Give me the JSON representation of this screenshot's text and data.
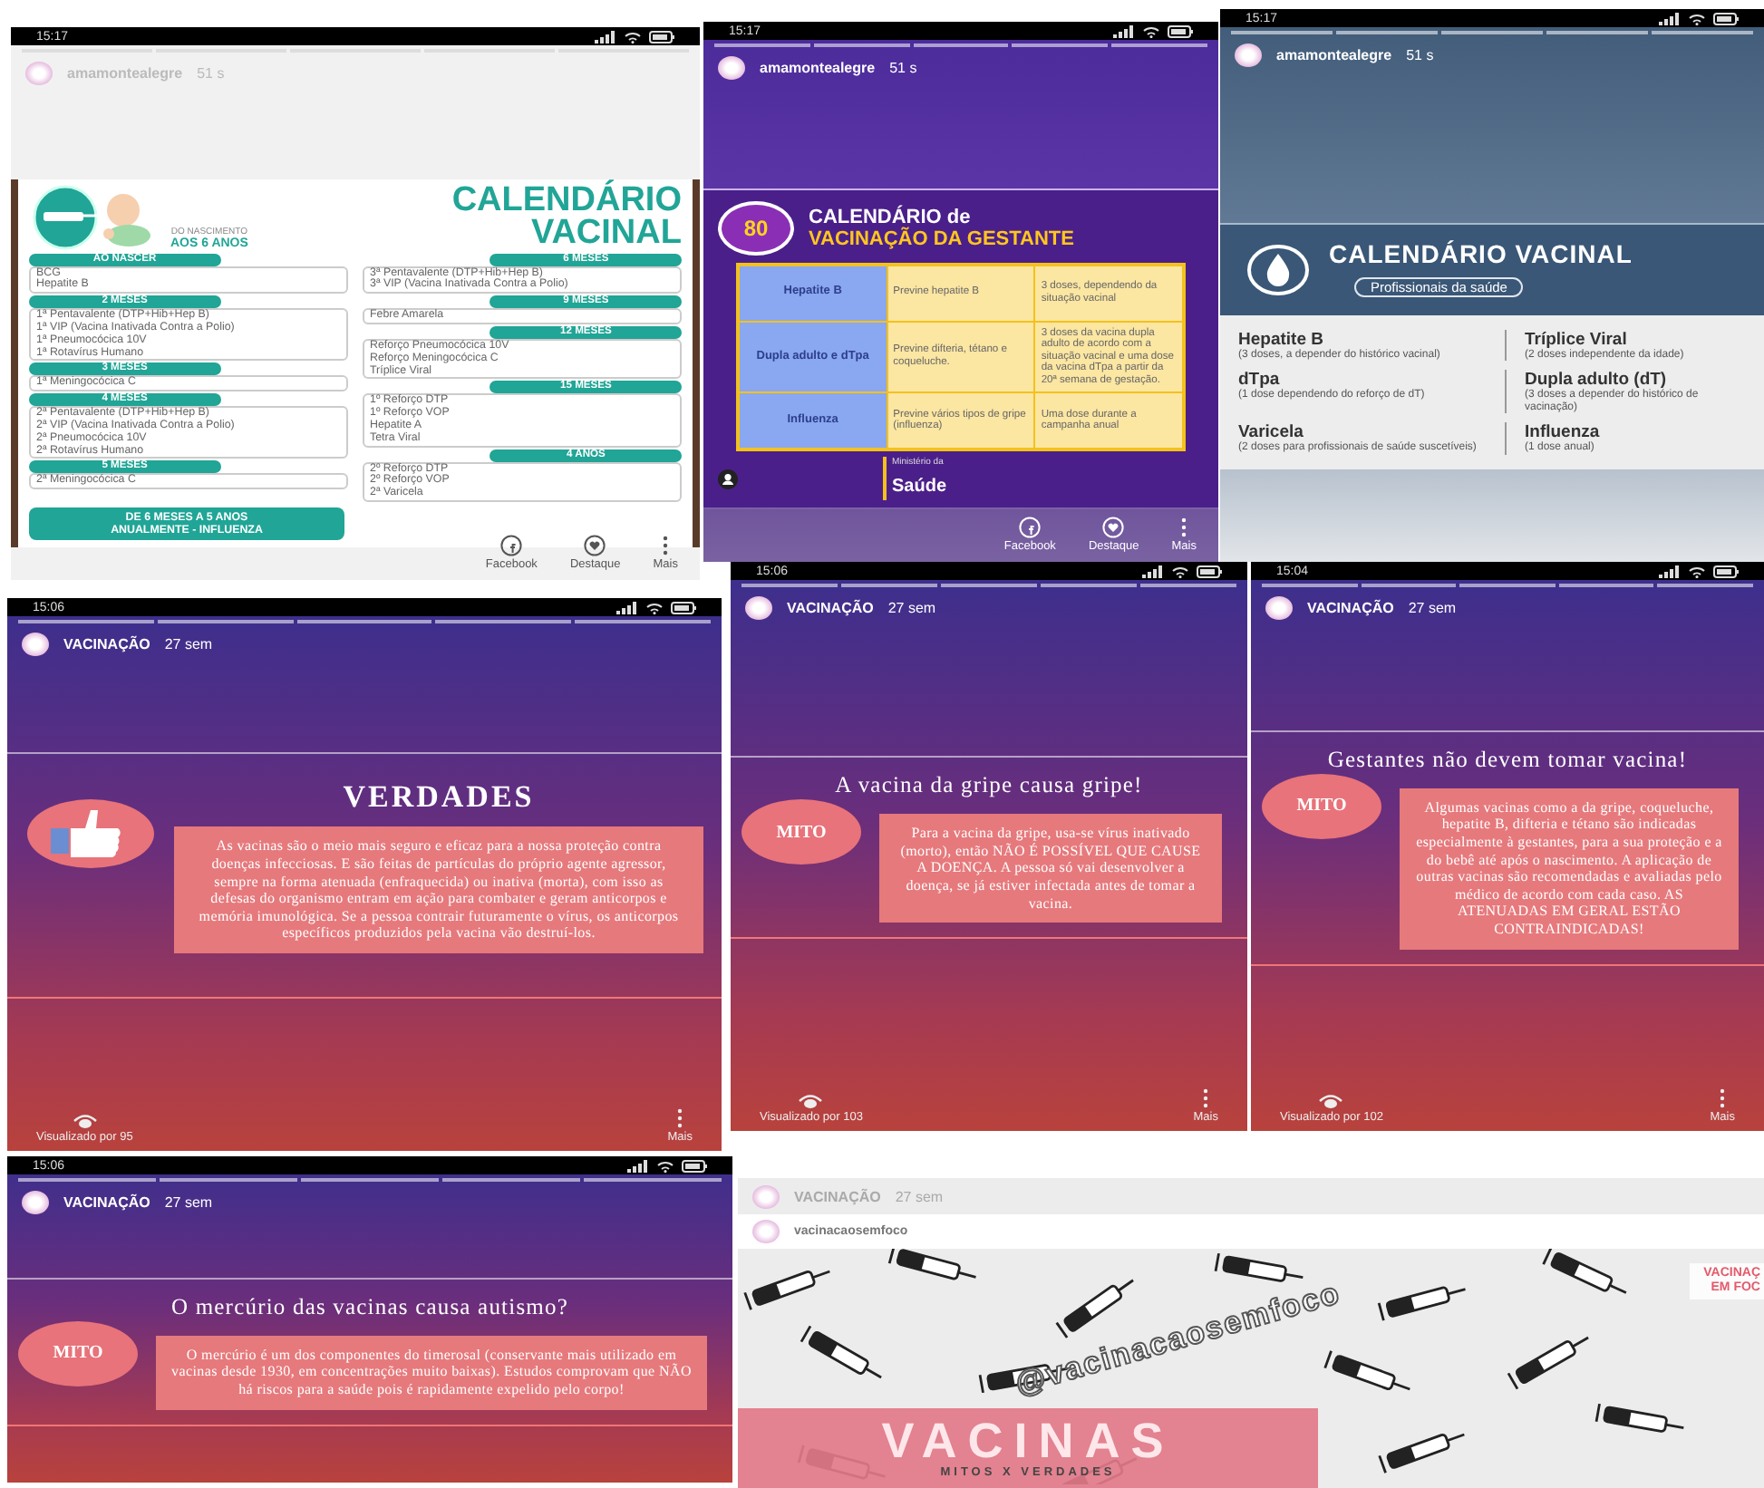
{
  "collage": [
    {
      "kind": "calendar-kids",
      "time": "15:17",
      "account": "amamontealegre",
      "age": "51 s",
      "title": "CALENDÁRIO",
      "title_2": "VACINAL",
      "subtitle": "DO NASCIMENTO",
      "subtitle_2": "AOS 6 ANOS",
      "left_sections": [
        {
          "label": "AO NASCER",
          "items": [
            "BCG",
            "Hepatite B"
          ]
        },
        {
          "label": "2 MESES",
          "items": [
            "1ª Pentavalente (DTP+Hib+Hep B)",
            "1ª VIP (Vacina Inativada Contra a Polio)",
            "1ª Pneumocócica 10V",
            "1ª Rotavírus Humano"
          ]
        },
        {
          "label": "3 MESES",
          "items": [
            "1ª Meningocócica C"
          ]
        },
        {
          "label": "4 MESES",
          "items": [
            "2ª Pentavalente (DTP+Hib+Hep B)",
            "2ª VIP (Vacina Inativada Contra a Polio)",
            "2ª Pneumocócica 10V",
            "2ª Rotavírus Humano"
          ]
        },
        {
          "label": "5 MESES",
          "items": [
            "2ª Meningocócica C"
          ]
        }
      ],
      "right_sections": [
        {
          "label": "6 MESES",
          "items": [
            "3ª Pentavalente (DTP+Hib+Hep B)",
            "3ª VIP (Vacina Inativada Contra a Polio)"
          ]
        },
        {
          "label": "9 MESES",
          "items": [
            "Febre Amarela"
          ]
        },
        {
          "label": "12 MESES",
          "items": [
            "Reforço Pneumocócica 10V",
            "Reforço Meningocócica C",
            "Tríplice Viral"
          ]
        },
        {
          "label": "15 MESES",
          "items": [
            "1º Reforço DTP",
            "1º Reforço VOP",
            "Hepatite A",
            "Tetra Viral"
          ]
        },
        {
          "label": "4 ANOS",
          "items": [
            "2º Reforço DTP",
            "2º Reforço VOP",
            "2ª Varicela"
          ]
        }
      ],
      "banner": "DE 6 MESES A 5 ANOS",
      "banner_2": "ANUALMENTE - INFLUENZA",
      "actions": [
        "Facebook",
        "Destaque",
        "Mais"
      ]
    },
    {
      "kind": "calendar-pregnant",
      "time": "15:17",
      "account": "amamontealegre",
      "age": "51 s",
      "badge": "80",
      "title": "CALENDÁRIO de",
      "title_2": "VACINAÇÃO DA GESTANTE",
      "rows": [
        [
          "Hepatite B",
          "Previne hepatite B",
          "3 doses, dependendo da situação vacinal"
        ],
        [
          "Dupla adulto e dTpa",
          "Previne difteria, tétano e coqueluche.",
          "3 doses da vacina dupla adulto de acordo com a situação vacinal e uma dose da vacina dTpa a partir da 20ª semana de gestação."
        ],
        [
          "Influenza",
          "Previne vários tipos de gripe (influenza)",
          "Uma dose durante a campanha anual"
        ]
      ],
      "logo_small": "Ministério da",
      "logo": "Saúde",
      "actions": [
        "Facebook",
        "Destaque",
        "Mais"
      ]
    },
    {
      "kind": "calendar-pro",
      "time": "15:17",
      "account": "amamontealegre",
      "age": "51 s",
      "title": "CALENDÁRIO VACINAL",
      "subtitle": "Profissionais da saúde",
      "items": [
        {
          "name": "Hepatite B",
          "note": "(3 doses, a depender do histórico vacinal)"
        },
        {
          "name": "Tríplice Viral",
          "note": "(2 doses independente da idade)"
        },
        {
          "name": "dTpa",
          "note": "(1 dose dependendo do reforço de dT)"
        },
        {
          "name": "Dupla adulto (dT)",
          "note": "(3 doses a depender do histórico de vacinação)"
        },
        {
          "name": "Varicela",
          "note": "(2 doses para profissionais de saúde suscetíveis)"
        },
        {
          "name": "Influenza",
          "note": "(1 dose anual)"
        }
      ]
    },
    {
      "kind": "truth",
      "time": "15:06",
      "account": "VACINAÇÃO",
      "age": "27 sem",
      "title": "VERDADES",
      "text": "As vacinas são o meio mais seguro e eficaz para a nossa proteção contra doenças infecciosas. E são feitas de partículas do próprio agente agressor, sempre na forma atenuada (enfraquecida) ou inativa (morta), com isso as defesas do organismo entram em ação para combater e geram anticorpos e memória imunológica. Se a pessoa contrair futuramente o vírus, os anticorpos específicos produzidos pela vacina vão destruí-los.",
      "viewers": "Visualizado por 95",
      "more": "Mais"
    },
    {
      "kind": "myth",
      "time": "15:06",
      "account": "VACINAÇÃO",
      "age": "27 sem",
      "title": "A vacina da gripe causa gripe!",
      "badge": "MITO",
      "text": "Para a vacina da gripe, usa-se vírus inativado (morto), então NÃO É POSSÍVEL QUE CAUSE A DOENÇA. A pessoa só vai desenvolver a doença, se já estiver infectada antes de tomar a vacina.",
      "viewers": "Visualizado por 103",
      "more": "Mais"
    },
    {
      "kind": "myth",
      "time": "15:04",
      "account": "VACINAÇÃO",
      "age": "27 sem",
      "title": "Gestantes não devem tomar vacina!",
      "badge": "MITO",
      "text": "Algumas vacinas como a da gripe, coqueluche, hepatite B, difteria e tétano são indicadas especialmente à gestantes, para a sua proteção e a do bebê até após o nascimento. A aplicação de outras vacinas são recomendadas e avaliadas pelo médico de acordo com cada caso. AS ATENUADAS EM GERAL ESTÃO CONTRAINDICADAS!",
      "viewers": "Visualizado por 102",
      "more": "Mais"
    },
    {
      "kind": "myth",
      "time": "15:06",
      "account": "VACINAÇÃO",
      "age": "27 sem",
      "title": "O mercúrio das vacinas causa autismo?",
      "badge": "MITO",
      "text": "O mercúrio é um dos componentes do timerosal (conservante mais utilizado em vacinas desde 1930, em concentrações muito baixas). Estudos comprovam que NÃO há riscos para a saúde pois é rapidamente expelido pelo corpo!"
    },
    {
      "kind": "cover",
      "account": "VACINAÇÃO",
      "age": "27 sem",
      "page": "vacinacaosemfoco",
      "handle": "@vacinacaosemfoco",
      "title": "VACINAS",
      "subtitle": "MITOS X VERDADES",
      "tag": "VACINAÇ",
      "tag_2": "EM FOC"
    }
  ]
}
